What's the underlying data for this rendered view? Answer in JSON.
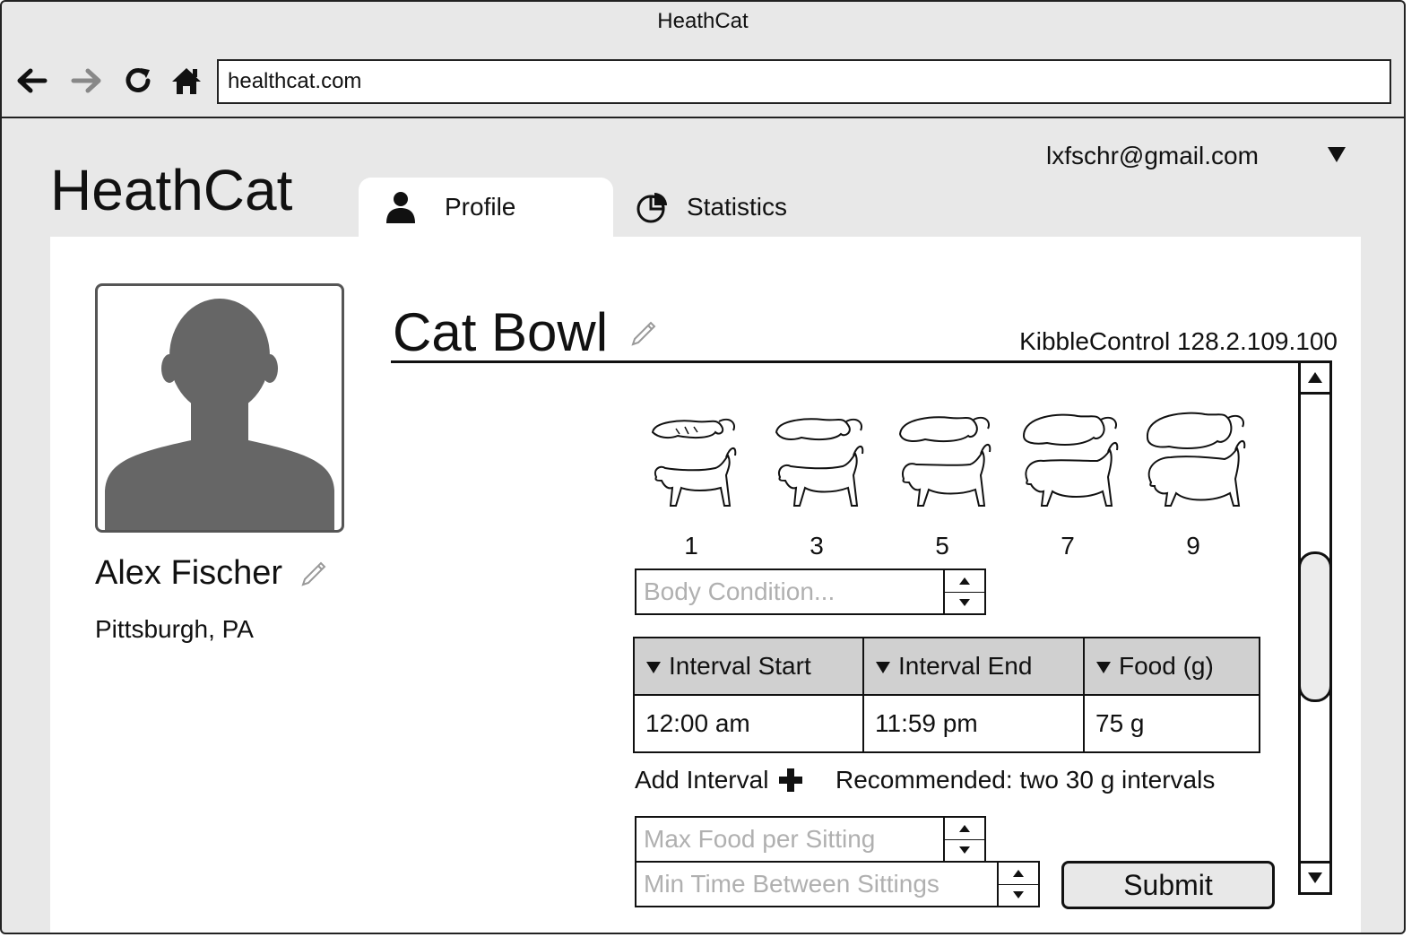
{
  "browser": {
    "title": "HeathCat",
    "url": "healthcat.com",
    "nav": {
      "back_icon": "arrow-left-icon",
      "forward_icon": "arrow-right-icon",
      "reload_icon": "reload-icon",
      "home_icon": "home-icon"
    }
  },
  "header": {
    "logo": "HeathCat",
    "account": "lxfschr@gmail.com",
    "tabs": [
      {
        "label": "Profile",
        "icon": "user-icon",
        "active": true
      },
      {
        "label": "Statistics",
        "icon": "pie-chart-icon",
        "active": false
      }
    ]
  },
  "profile": {
    "name": "Alex Fischer",
    "location": "Pittsburgh, PA"
  },
  "device": {
    "title": "Cat Bowl",
    "address": "KibbleControl 128.2.109.100",
    "body_condition_scale": [
      "1",
      "3",
      "5",
      "7",
      "9"
    ],
    "body_condition_placeholder": "Body Condition...",
    "table": {
      "headers": [
        "Interval Start",
        "Interval End",
        "Food (g)"
      ],
      "rows": [
        [
          "12:00 am",
          "11:59 pm",
          "75 g"
        ]
      ]
    },
    "add_interval_label": "Add Interval",
    "recommendation": "Recommended: two 30 g intervals",
    "max_food_placeholder": "Max Food per Sitting",
    "min_time_placeholder": "Min Time Between Sittings",
    "submit_label": "Submit"
  },
  "colors": {
    "window_bg": "#e8e8e8",
    "panel_bg": "#ffffff",
    "header_fill": "#d0d0d0",
    "silhouette": "#666666"
  }
}
